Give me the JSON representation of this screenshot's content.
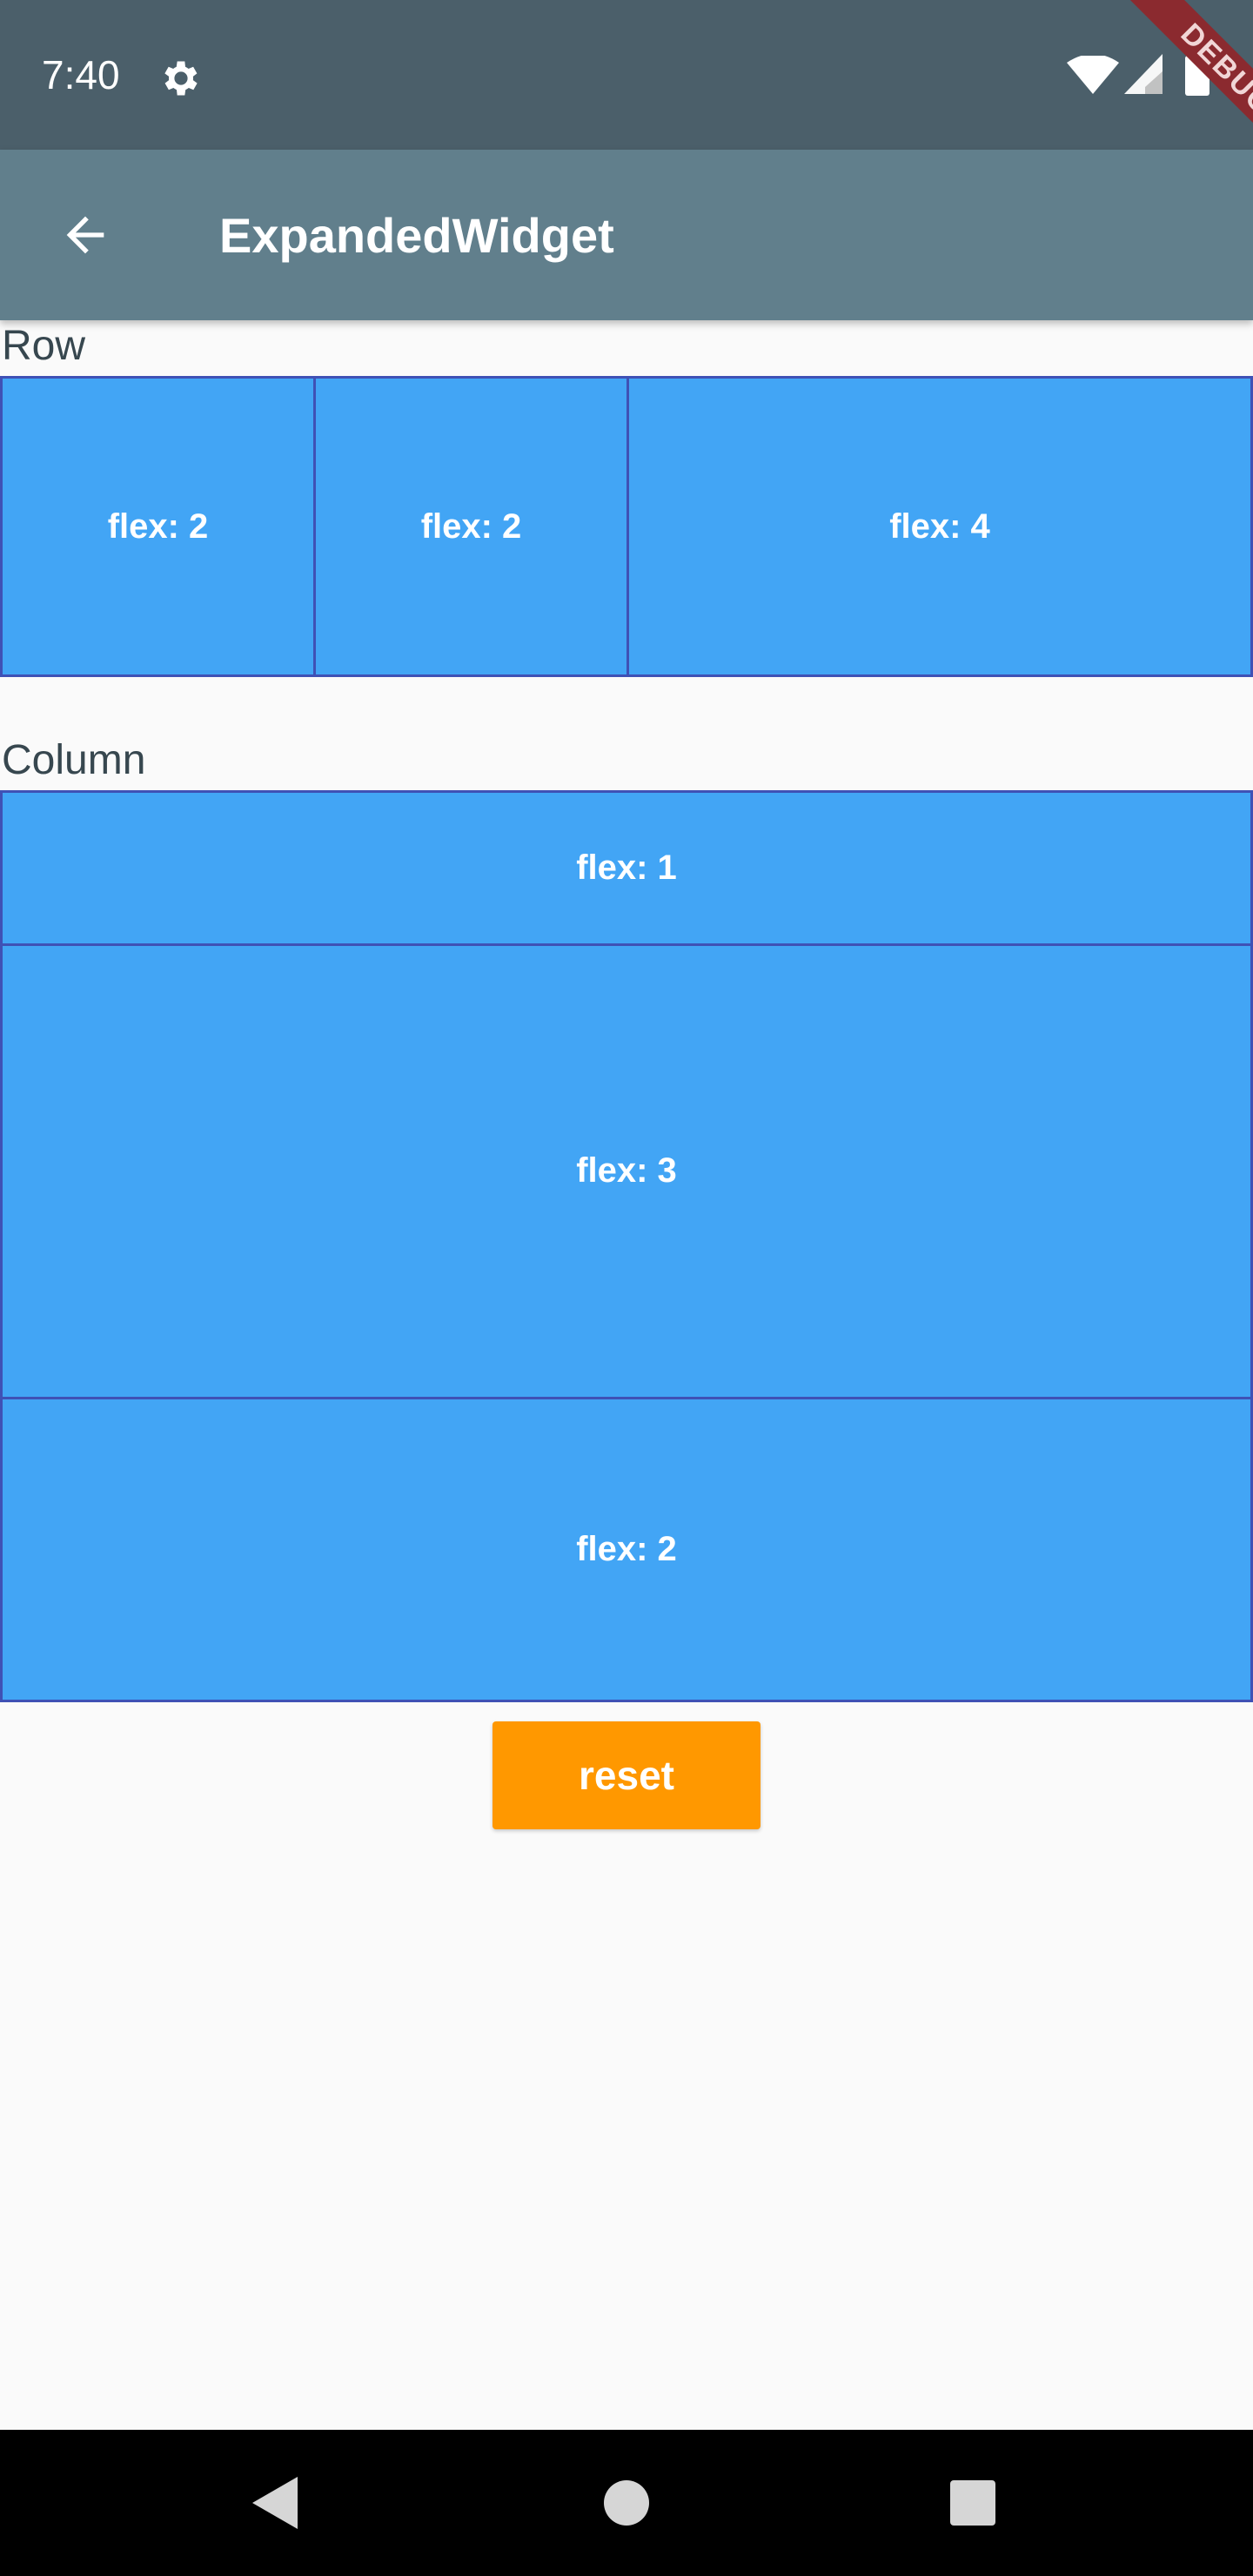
{
  "status_bar": {
    "time": "7:40",
    "debug_banner": "DEBUG"
  },
  "app_bar": {
    "title": "ExpandedWidget",
    "back_icon": "arrow-back-icon"
  },
  "row_section": {
    "label": "Row",
    "items": [
      {
        "label": "flex: 2",
        "flex": 2
      },
      {
        "label": "flex: 2",
        "flex": 2
      },
      {
        "label": "flex: 4",
        "flex": 4
      }
    ]
  },
  "column_section": {
    "label": "Column",
    "items": [
      {
        "label": "flex: 1",
        "flex": 1
      },
      {
        "label": "flex: 3",
        "flex": 3
      },
      {
        "label": "flex: 2",
        "flex": 2
      }
    ]
  },
  "reset_button": {
    "label": "reset"
  },
  "colors": {
    "status_bar": "#4b5f6a",
    "app_bar": "#617f8c",
    "box_fill": "#42a5f5",
    "box_border": "#3f51b5",
    "reset_button": "#ff9800",
    "background": "#fafafa"
  },
  "nav_bar": {
    "icons": [
      "back-triangle-icon",
      "home-circle-icon",
      "recents-square-icon"
    ]
  }
}
